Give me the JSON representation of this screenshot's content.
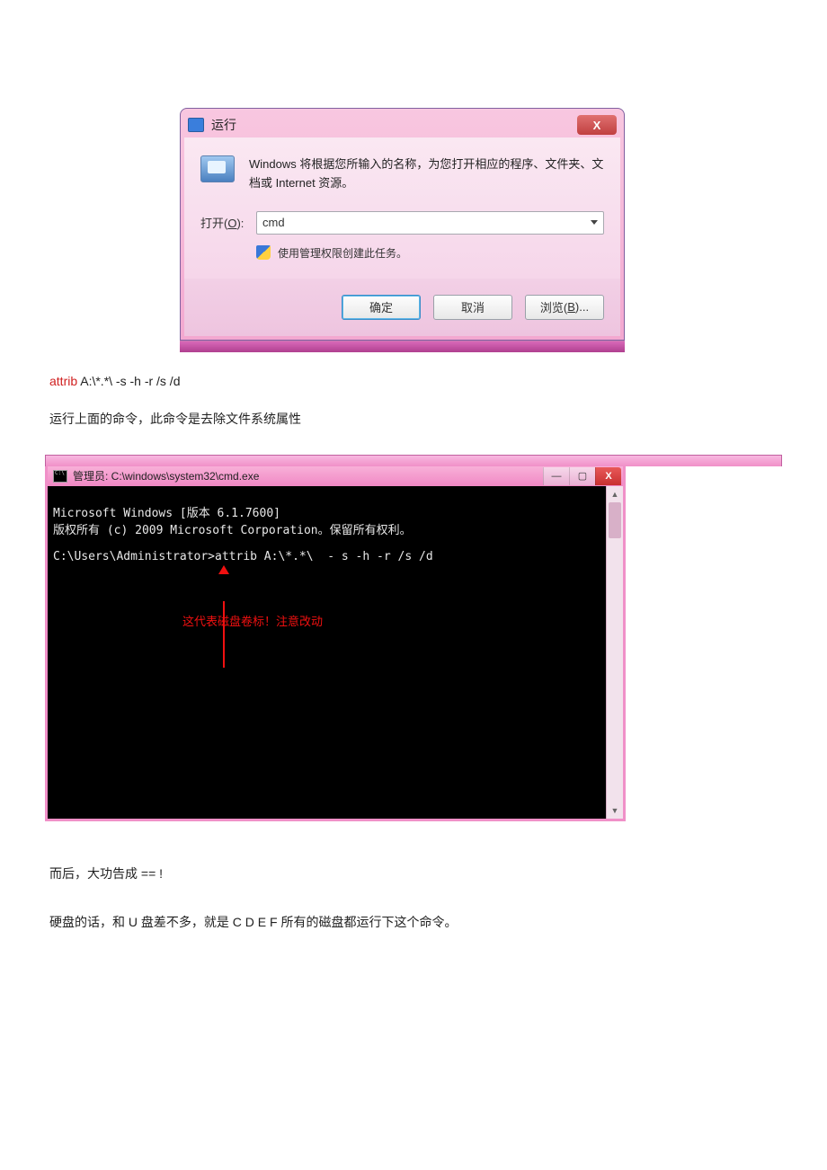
{
  "run_dialog": {
    "title": "运行",
    "description": "Windows 将根据您所输入的名称，为您打开相应的程序、文件夹、文档或 Internet 资源。",
    "open_label_prefix": "打开(",
    "open_label_accel": "O",
    "open_label_suffix": "):",
    "open_value": "cmd",
    "admin_note": "使用管理权限创建此任务。",
    "buttons": {
      "ok": "确定",
      "cancel": "取消",
      "browse_prefix": "浏览(",
      "browse_accel": "B",
      "browse_suffix": ")..."
    },
    "close_glyph": "X"
  },
  "doc": {
    "cmd_keyword": "attrib",
    "cmd_rest": " A:\\*.*\\    -s -h -r /s /d",
    "explain": "运行上面的命令，此命令是去除文件系统属性",
    "after1": "而后，大功告成  == !",
    "after2": "硬盘的话，和 U 盘差不多，就是 C    D    E      F 所有的磁盘都运行下这个命令。"
  },
  "cmd_window": {
    "title": "管理员: C:\\windows\\system32\\cmd.exe",
    "line1": "Microsoft Windows [版本 6.1.7600]",
    "line2": "版权所有 (c) 2009 Microsoft Corporation。保留所有权利。",
    "line3": "C:\\Users\\Administrator>attrib A:\\*.*\\  - s -h -r /s /d",
    "annotation": "这代表磁盘卷标！注意改动",
    "controls": {
      "min": "—",
      "max": "▢",
      "close": "X"
    },
    "scroll": {
      "up": "▲",
      "down": "▼"
    }
  }
}
